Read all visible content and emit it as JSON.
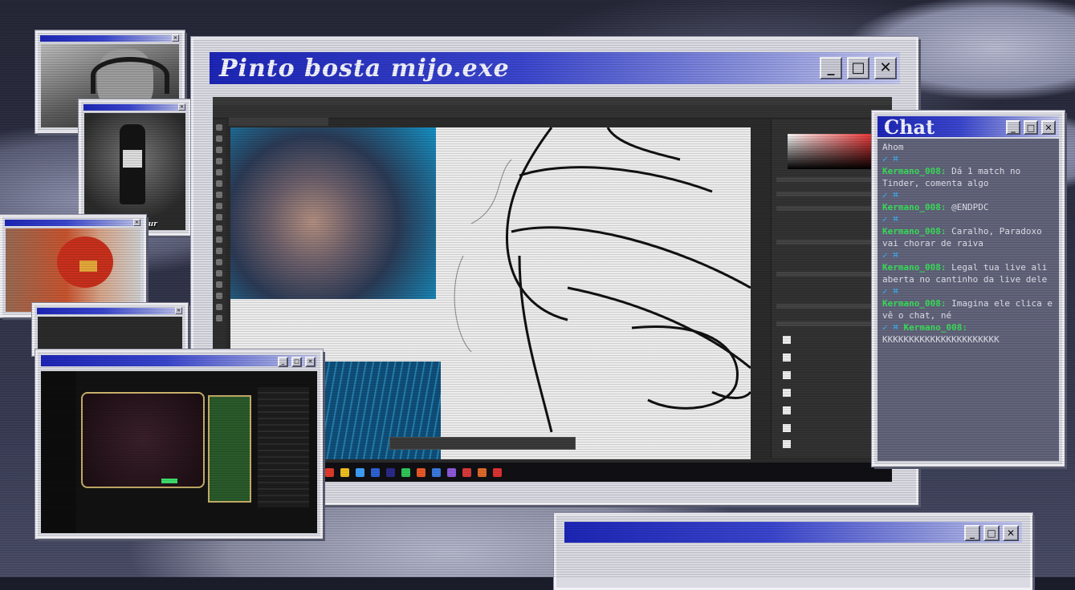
{
  "main_window": {
    "title": "Pinto bosta mijo.exe",
    "controls": {
      "minimize": "_",
      "maximize": "□",
      "close": "✕"
    }
  },
  "chat_window": {
    "title": "Chat",
    "controls": {
      "minimize": "_",
      "maximize": "□",
      "close": "✕"
    },
    "messages": [
      {
        "user": "",
        "text": "Ahom"
      },
      {
        "user": "Kermano_008:",
        "text": "Dá 1 match no Tinder, comenta algo"
      },
      {
        "user": "Kermano_008:",
        "text": "@ENDPDC"
      },
      {
        "user": "Kermano_008:",
        "text": "Caralho, Paradoxo vai chorar de raiva"
      },
      {
        "user": "Kermano_008:",
        "text": "Legal tua live ali aberta no cantinho da live dele"
      },
      {
        "user": "Kermano_008:",
        "text": "Imagina ele clica e vê o chat, né"
      },
      {
        "user": "Kermano_008:",
        "text": "KKKKKKKKKKKKKKKKKKKKKK"
      }
    ]
  },
  "webcam_overlay": {
    "label": "Tung Tung Sahur"
  },
  "colors": {
    "titlebar_start": "#1d26b8",
    "titlebar_end": "#c4c8ee",
    "window_face": "#d9dae2",
    "chat_bg": "#62647b",
    "chat_user": "#39e15a"
  },
  "icons": [
    "minimize-icon",
    "maximize-icon",
    "close-icon",
    "photoshop-toolbar",
    "taskbar-icons"
  ]
}
